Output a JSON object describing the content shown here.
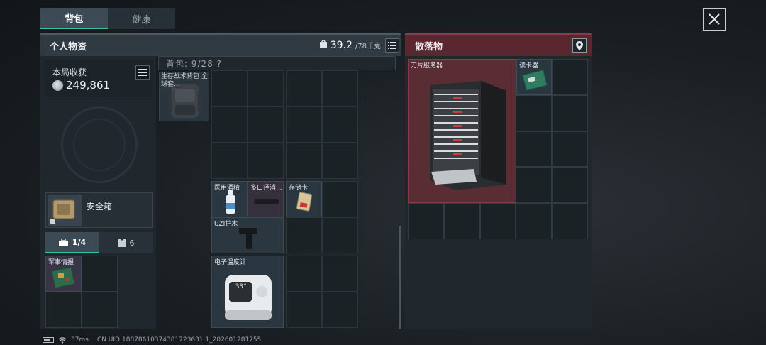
{
  "tabs": [
    {
      "label": "背包",
      "active": true
    },
    {
      "label": "健康",
      "active": false
    }
  ],
  "personal": {
    "title": "个人物资",
    "weight_current": "39.2",
    "weight_max": "/78千克"
  },
  "harvest": {
    "label": "本局收获",
    "value": "249,861"
  },
  "safebox": {
    "label": "安全箱"
  },
  "subtabs": [
    {
      "label": "1/4",
      "icon": "toolbox-icon",
      "active": true
    },
    {
      "label": "6",
      "icon": "clipboard-icon",
      "active": false
    }
  ],
  "backpack": {
    "capacity_label": "背包: 9/28 ?",
    "item_name": "生存战术背包 全球套...",
    "items": [
      {
        "name": "医用酒精"
      },
      {
        "name": "多口径消..."
      },
      {
        "name": "存储卡"
      },
      {
        "name": "UZI护木"
      },
      {
        "name": "电子温度计"
      }
    ]
  },
  "safe_items": [
    {
      "name": "军事情报"
    }
  ],
  "loot": {
    "title": "散落物",
    "items": [
      {
        "name": "刀片服务器"
      },
      {
        "name": "读卡器"
      }
    ]
  },
  "thermometer_display": "33°",
  "status": {
    "ping": "37ms",
    "uid": "CN UID:18878610374381723631 1_202601281755"
  },
  "colors": {
    "accent": "#33c4a8",
    "loot_red": "#5a2730",
    "panel": "#20282e"
  }
}
